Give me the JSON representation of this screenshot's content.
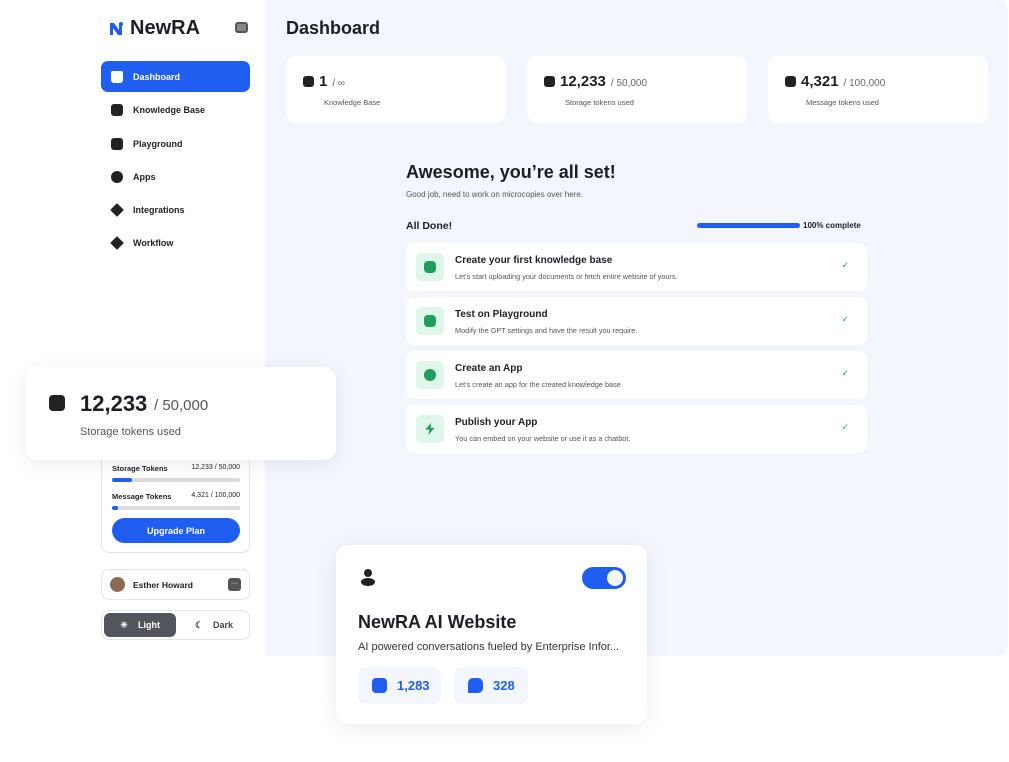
{
  "brand": {
    "name": "NewRA"
  },
  "sidebar": {
    "items": [
      {
        "label": "Dashboard",
        "icon": "home-icon"
      },
      {
        "label": "Knowledge Base",
        "icon": "knowledge-icon"
      },
      {
        "label": "Playground",
        "icon": "playground-icon"
      },
      {
        "label": "Apps",
        "icon": "apps-icon"
      },
      {
        "label": "Integrations",
        "icon": "integrations-icon"
      },
      {
        "label": "Workflow",
        "icon": "workflow-icon"
      }
    ],
    "plan": {
      "storage_label": "Storage Tokens",
      "storage_value": "12,233 / 50,000",
      "storage_pct": 24,
      "message_label": "Message Tokens",
      "message_value": "4,321 / 100,000",
      "message_pct": 4,
      "upgrade": "Upgrade Plan"
    },
    "user": {
      "name": "Esther Howard",
      "menu": "···"
    },
    "theme": {
      "light": "Light",
      "dark": "Dark",
      "selected": "Light"
    }
  },
  "header": {
    "title": "Dashboard"
  },
  "stats": [
    {
      "value": "1",
      "of": "/ ∞",
      "label": "Knowledge Base"
    },
    {
      "value": "12,233",
      "of": "/ 50,000",
      "label": "Storage tokens used"
    },
    {
      "value": "4,321",
      "of": "/ 100,000",
      "label": "Message tokens used"
    }
  ],
  "onboarding": {
    "title": "Awesome, you’re all set!",
    "subtitle": "Good job, need to work on microcopies over here.",
    "status": "All Done!",
    "progress_pct": 100,
    "progress_label": "100% complete",
    "tasks": [
      {
        "title": "Create your first knowledge base",
        "desc": "Let’s start uploading your documents or fetch entire website of yours.",
        "check": "✓"
      },
      {
        "title": "Test on Playground",
        "desc": "Modify the GPT settings and have the result you require.",
        "check": "✓"
      },
      {
        "title": "Create an App",
        "desc": "Let’s create an app for the created knowledge base",
        "check": "✓"
      },
      {
        "title": "Publish your App",
        "desc": "You can embed on your website or use it as a chatbot.",
        "check": "✓"
      }
    ]
  },
  "float_stat": {
    "value": "12,233",
    "of": "/ 50,000",
    "label": "Storage tokens used"
  },
  "app_card": {
    "title": "NewRA AI Website",
    "desc": "AI powered conversations fueled by Enterprise Infor...",
    "enabled": true,
    "storage": "1,283",
    "messages": "328"
  },
  "colors": {
    "accent": "#1f5ef0",
    "success": "#1f9e5c"
  }
}
